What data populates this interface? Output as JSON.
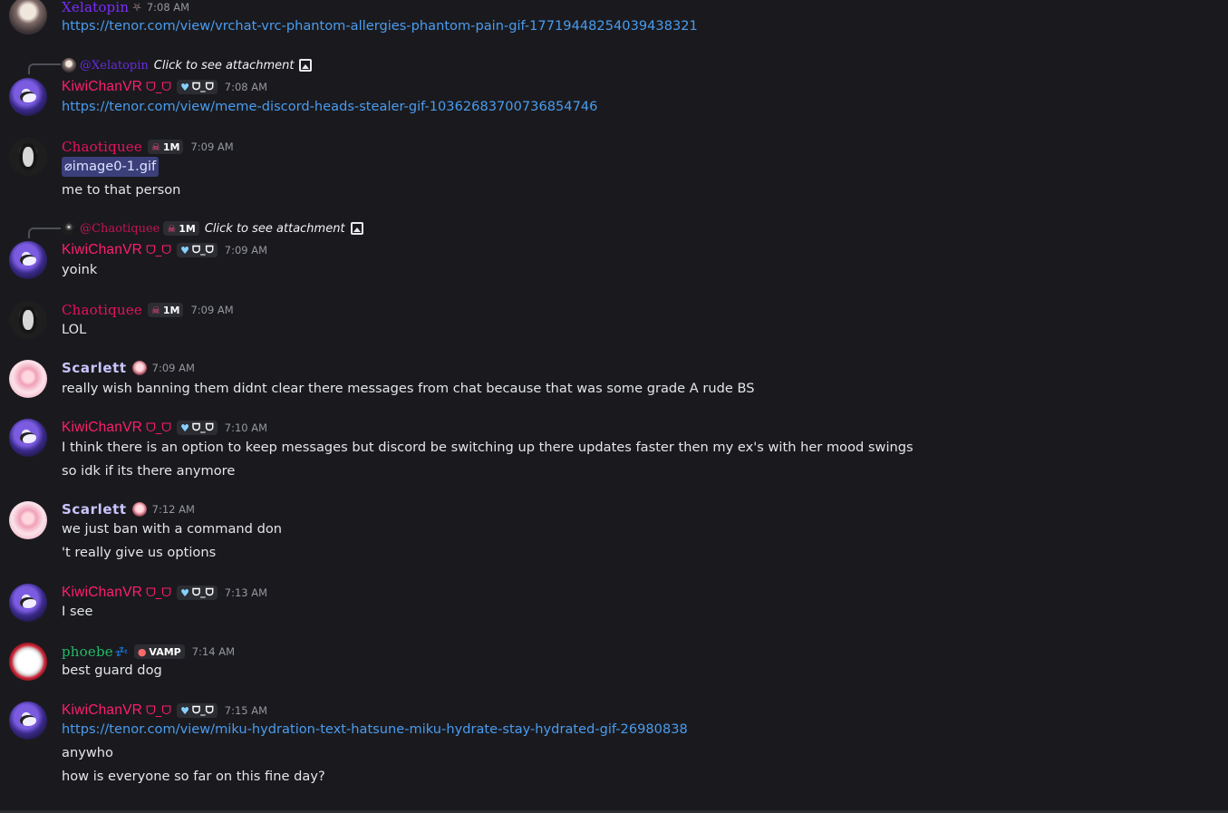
{
  "messages": [
    {
      "author": "Xelatopin",
      "time": "7:08 AM",
      "lines": [
        "https://tenor.com/view/vrchat-vrc-phantom-allergies-phantom-pain-gif-17719448254039438321"
      ]
    },
    {
      "reply": {
        "mention": "@Xelatopin",
        "cta": "Click to see attachment"
      },
      "author": "KiwiChanVR",
      "author_glyph": "ᗜ_ᗜ",
      "tag": "ᗜ_ᗜ",
      "time": "7:08 AM",
      "lines": [
        "https://tenor.com/view/meme-discord-heads-stealer-gif-10362683700736854746"
      ]
    },
    {
      "author": "Chaotiquee",
      "tag": "1M",
      "time": "7:09 AM",
      "attachment": "image0-1.gif",
      "lines": [
        "me to that person"
      ]
    },
    {
      "reply": {
        "mention": "@Chaotiquee",
        "tag": "1M",
        "cta": "Click to see attachment"
      },
      "author": "KiwiChanVR",
      "author_glyph": "ᗜ_ᗜ",
      "tag": "ᗜ_ᗜ",
      "time": "7:09 AM",
      "lines": [
        "yoink"
      ]
    },
    {
      "author": "Chaotiquee",
      "tag": "1M",
      "time": "7:09 AM",
      "lines": [
        "LOL"
      ]
    },
    {
      "author": "Scarlett",
      "time": "7:09 AM",
      "lines": [
        "really wish banning them didnt clear there messages from chat because that was some grade A rude BS"
      ]
    },
    {
      "author": "KiwiChanVR",
      "author_glyph": "ᗜ_ᗜ",
      "tag": "ᗜ_ᗜ",
      "time": "7:10 AM",
      "lines": [
        "I think there is an option to keep messages but discord be switching up there updates faster then my ex's with her mood swings",
        "so idk if its there anymore"
      ]
    },
    {
      "author": "Scarlett",
      "time": "7:12 AM",
      "lines": [
        "we just ban with a command don",
        "'t really give us options"
      ]
    },
    {
      "author": "KiwiChanVR",
      "author_glyph": "ᗜ_ᗜ",
      "tag": "ᗜ_ᗜ",
      "time": "7:13 AM",
      "lines": [
        "I see"
      ]
    },
    {
      "author": "phoebe",
      "author_glyph": "💤",
      "tag": "VAMP",
      "time": "7:14 AM",
      "lines": [
        "best guard dog"
      ]
    },
    {
      "author": "KiwiChanVR",
      "author_glyph": "ᗜ_ᗜ",
      "tag": "ᗜ_ᗜ",
      "time": "7:15 AM",
      "lines": [
        "https://tenor.com/view/miku-hydration-text-hatsune-miku-hydrate-stay-hydrated-gif-26980838",
        "anywho",
        "how is everyone so far on this fine day?"
      ]
    }
  ],
  "colors": {
    "background": "#1a1a1e",
    "link": "#4a9cf0",
    "kiwi": "#ff1f6a",
    "chaotiquee": "#e8115f",
    "scarlett": "#c9c4ff",
    "phoebe": "#23b968",
    "xelatopin": "#7b2cff",
    "timestamp": "#94979e"
  },
  "icons": [
    "image-icon",
    "paperclip-icon",
    "heart-icon",
    "skull-icon",
    "drop-icon"
  ]
}
